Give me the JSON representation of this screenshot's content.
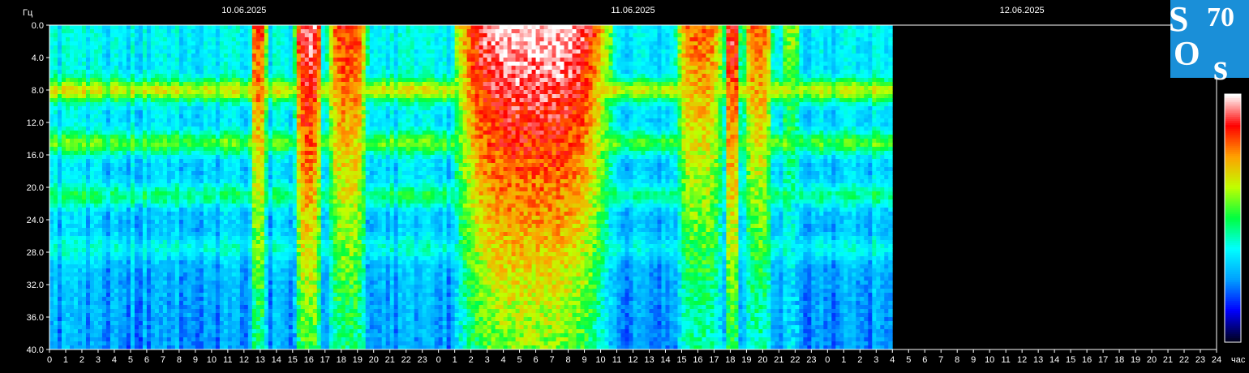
{
  "chart_data": {
    "type": "heatmap",
    "title": "",
    "ylabel": "Гц",
    "xlabel": "час",
    "ylim": [
      0,
      40
    ],
    "y_ticks": [
      "0.0",
      "4.0",
      "8.0",
      "12.0",
      "16.0",
      "20.0",
      "24.0",
      "28.0",
      "32.0",
      "36.0",
      "40.0"
    ],
    "x_ticks": [
      "0",
      "1",
      "2",
      "3",
      "4",
      "5",
      "6",
      "7",
      "8",
      "9",
      "10",
      "11",
      "12",
      "13",
      "14",
      "15",
      "16",
      "17",
      "18",
      "19",
      "20",
      "21",
      "22",
      "23",
      "0",
      "1",
      "2",
      "3",
      "4",
      "5",
      "6",
      "7",
      "8",
      "9",
      "10",
      "11",
      "12",
      "13",
      "14",
      "15",
      "16",
      "17",
      "18",
      "19",
      "20",
      "21",
      "22",
      "23",
      "0",
      "1",
      "2",
      "3",
      "4",
      "5",
      "6",
      "7",
      "8",
      "9",
      "10",
      "11",
      "12",
      "13",
      "14",
      "15",
      "16",
      "17",
      "18",
      "19",
      "20",
      "21",
      "22",
      "23",
      "24"
    ],
    "dates": [
      "10.06.2025",
      "11.06.2025",
      "12.06.2025"
    ],
    "x_range_hours": [
      0,
      72
    ],
    "data_end_hour": 52,
    "resonance_bands_hz": [
      7.8,
      14.3,
      20.8,
      27.3
    ],
    "high_intensity_windows_hours": [
      {
        "start": 12.3,
        "end": 13.3,
        "level": 0.85
      },
      {
        "start": 15.0,
        "end": 16.7,
        "level": 0.95
      },
      {
        "start": 17.0,
        "end": 19.5,
        "level": 0.85
      },
      {
        "start": 24.8,
        "end": 34.5,
        "level": 1.0
      },
      {
        "start": 38.5,
        "end": 41.5,
        "level": 0.8
      },
      {
        "start": 41.5,
        "end": 42.5,
        "level": 0.9
      },
      {
        "start": 42.7,
        "end": 44.5,
        "level": 0.8
      },
      {
        "start": 45.0,
        "end": 46.2,
        "level": 0.6
      }
    ],
    "colorbar": [
      "#000020",
      "#0000ff",
      "#00a0ff",
      "#00ffff",
      "#00ff40",
      "#c0ff00",
      "#ffa000",
      "#ff0000",
      "#ffffff"
    ],
    "grid": false
  },
  "logo": {
    "lines": [
      "S",
      "70",
      "O",
      "s"
    ],
    "bg_color": "#1a8fd8"
  }
}
